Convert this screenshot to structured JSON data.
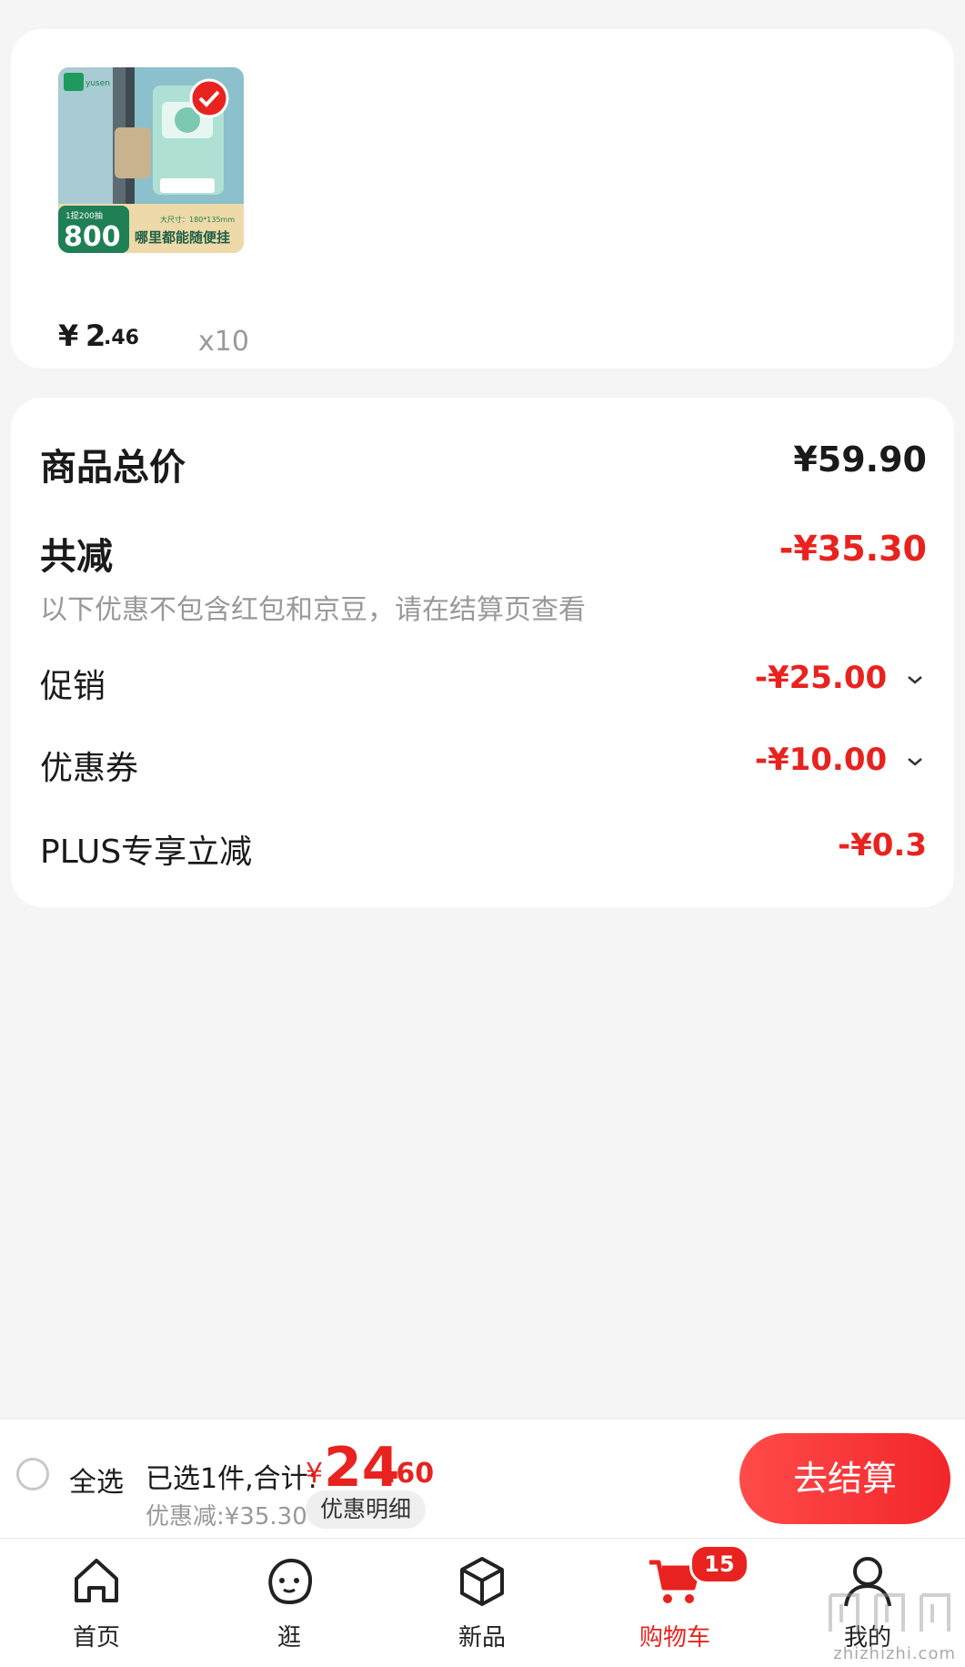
{
  "product": {
    "price_yen": "¥",
    "price_int": "2",
    "price_dec": ".46",
    "quantity": "x10",
    "thumb_texts": {
      "brand": "yusen",
      "count": "800",
      "badge": "1提200抽",
      "size": "大尺寸：180*135mm",
      "slogan": "哪里都能随便挂"
    }
  },
  "summary": {
    "total_label": "商品总价",
    "total_value": "¥59.90",
    "reduce_label": "共减",
    "reduce_value": "-¥35.30",
    "note": "以下优惠不包含红包和京豆，请在结算页查看",
    "promo_label": "促销",
    "promo_value": "-¥25.00",
    "coupon_label": "优惠券",
    "coupon_value": "-¥10.00",
    "plus_label": "PLUS专享立减",
    "plus_value": "-¥0.3"
  },
  "checkout": {
    "select_all": "全选",
    "selected_text": "已选1件,合计:",
    "total_yen": "¥",
    "total_int": "24",
    "total_dec": ".60",
    "discount_text": "优惠减:¥35.30",
    "detail_label": "优惠明细",
    "button_label": "去结算"
  },
  "tabs": [
    {
      "label": "首页",
      "icon": "home-icon"
    },
    {
      "label": "逛",
      "icon": "face-icon"
    },
    {
      "label": "新品",
      "icon": "cube-icon"
    },
    {
      "label": "购物车",
      "icon": "cart-icon",
      "badge": "15",
      "active": true
    },
    {
      "label": "我的",
      "icon": "user-icon"
    }
  ],
  "watermark": "zhizhizhi.com",
  "colors": {
    "accent": "#e8231f",
    "background": "#f5f5f5"
  }
}
